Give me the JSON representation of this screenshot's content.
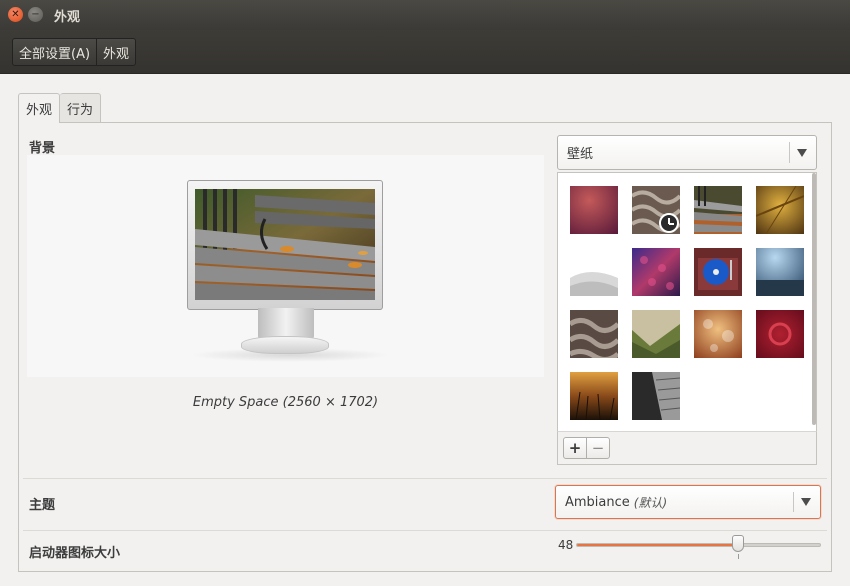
{
  "window": {
    "title": "外观"
  },
  "toolbar": {
    "breadcrumbs": [
      "全部设置(A)",
      "外观"
    ]
  },
  "tabs": [
    {
      "label": "外观",
      "active": true
    },
    {
      "label": "行为",
      "active": false
    }
  ],
  "background": {
    "section_label": "背景",
    "source_combo": "壁纸",
    "caption": "Empty Space (2560 × 1702)",
    "add_label": "+",
    "remove_label": "−",
    "wallpapers": [
      {
        "name": "purple-gradient-wallpaper",
        "selected": false
      },
      {
        "name": "rope-knot-wallpaper",
        "selected": false,
        "slideshow": true
      },
      {
        "name": "bench-wallpaper",
        "selected": true
      },
      {
        "name": "amber-leaf-wallpaper",
        "selected": false
      },
      {
        "name": "sand-dunes-wallpaper",
        "selected": false
      },
      {
        "name": "colored-cobblestone-wallpaper",
        "selected": false
      },
      {
        "name": "turntable-wallpaper",
        "selected": false
      },
      {
        "name": "blue-sea-wallpaper",
        "selected": false
      },
      {
        "name": "rope-knot-wallpaper-2",
        "selected": false
      },
      {
        "name": "mountain-valley-wallpaper",
        "selected": false
      },
      {
        "name": "bokeh-lights-wallpaper",
        "selected": false
      },
      {
        "name": "red-ubuntu-wallpaper",
        "selected": false
      },
      {
        "name": "sunset-grass-wallpaper",
        "selected": false
      },
      {
        "name": "bw-building-wallpaper",
        "selected": false
      }
    ]
  },
  "theme": {
    "label": "主题",
    "value": "Ambiance",
    "hint": "(默认)"
  },
  "launcher": {
    "label": "启动器图标大小",
    "value": "48",
    "fraction": 0.66
  },
  "colors": {
    "accent": "#e9743f",
    "titlebar": "#3b3a36"
  }
}
